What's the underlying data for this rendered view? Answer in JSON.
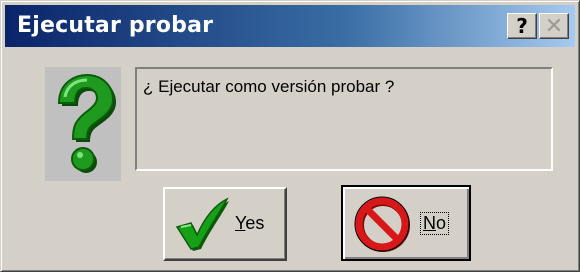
{
  "window": {
    "title": "Ejecutar probar",
    "help_glyph": "?",
    "close_glyph": "✕"
  },
  "message": {
    "text": "¿ Ejecutar como versión probar  ?",
    "icon": "question-mark-icon"
  },
  "buttons": {
    "yes": {
      "mnemonic": "Y",
      "rest": "es",
      "icon": "checkmark-icon"
    },
    "no": {
      "mnemonic": "N",
      "rest": "o",
      "icon": "prohibited-icon"
    }
  },
  "colors": {
    "titlebar_start": "#0a246a",
    "titlebar_end": "#a6caf0",
    "dialog_face": "#d4d0c8",
    "question_green": "#1e9a1e",
    "check_green": "#16a016",
    "prohibit_red": "#d81818"
  }
}
